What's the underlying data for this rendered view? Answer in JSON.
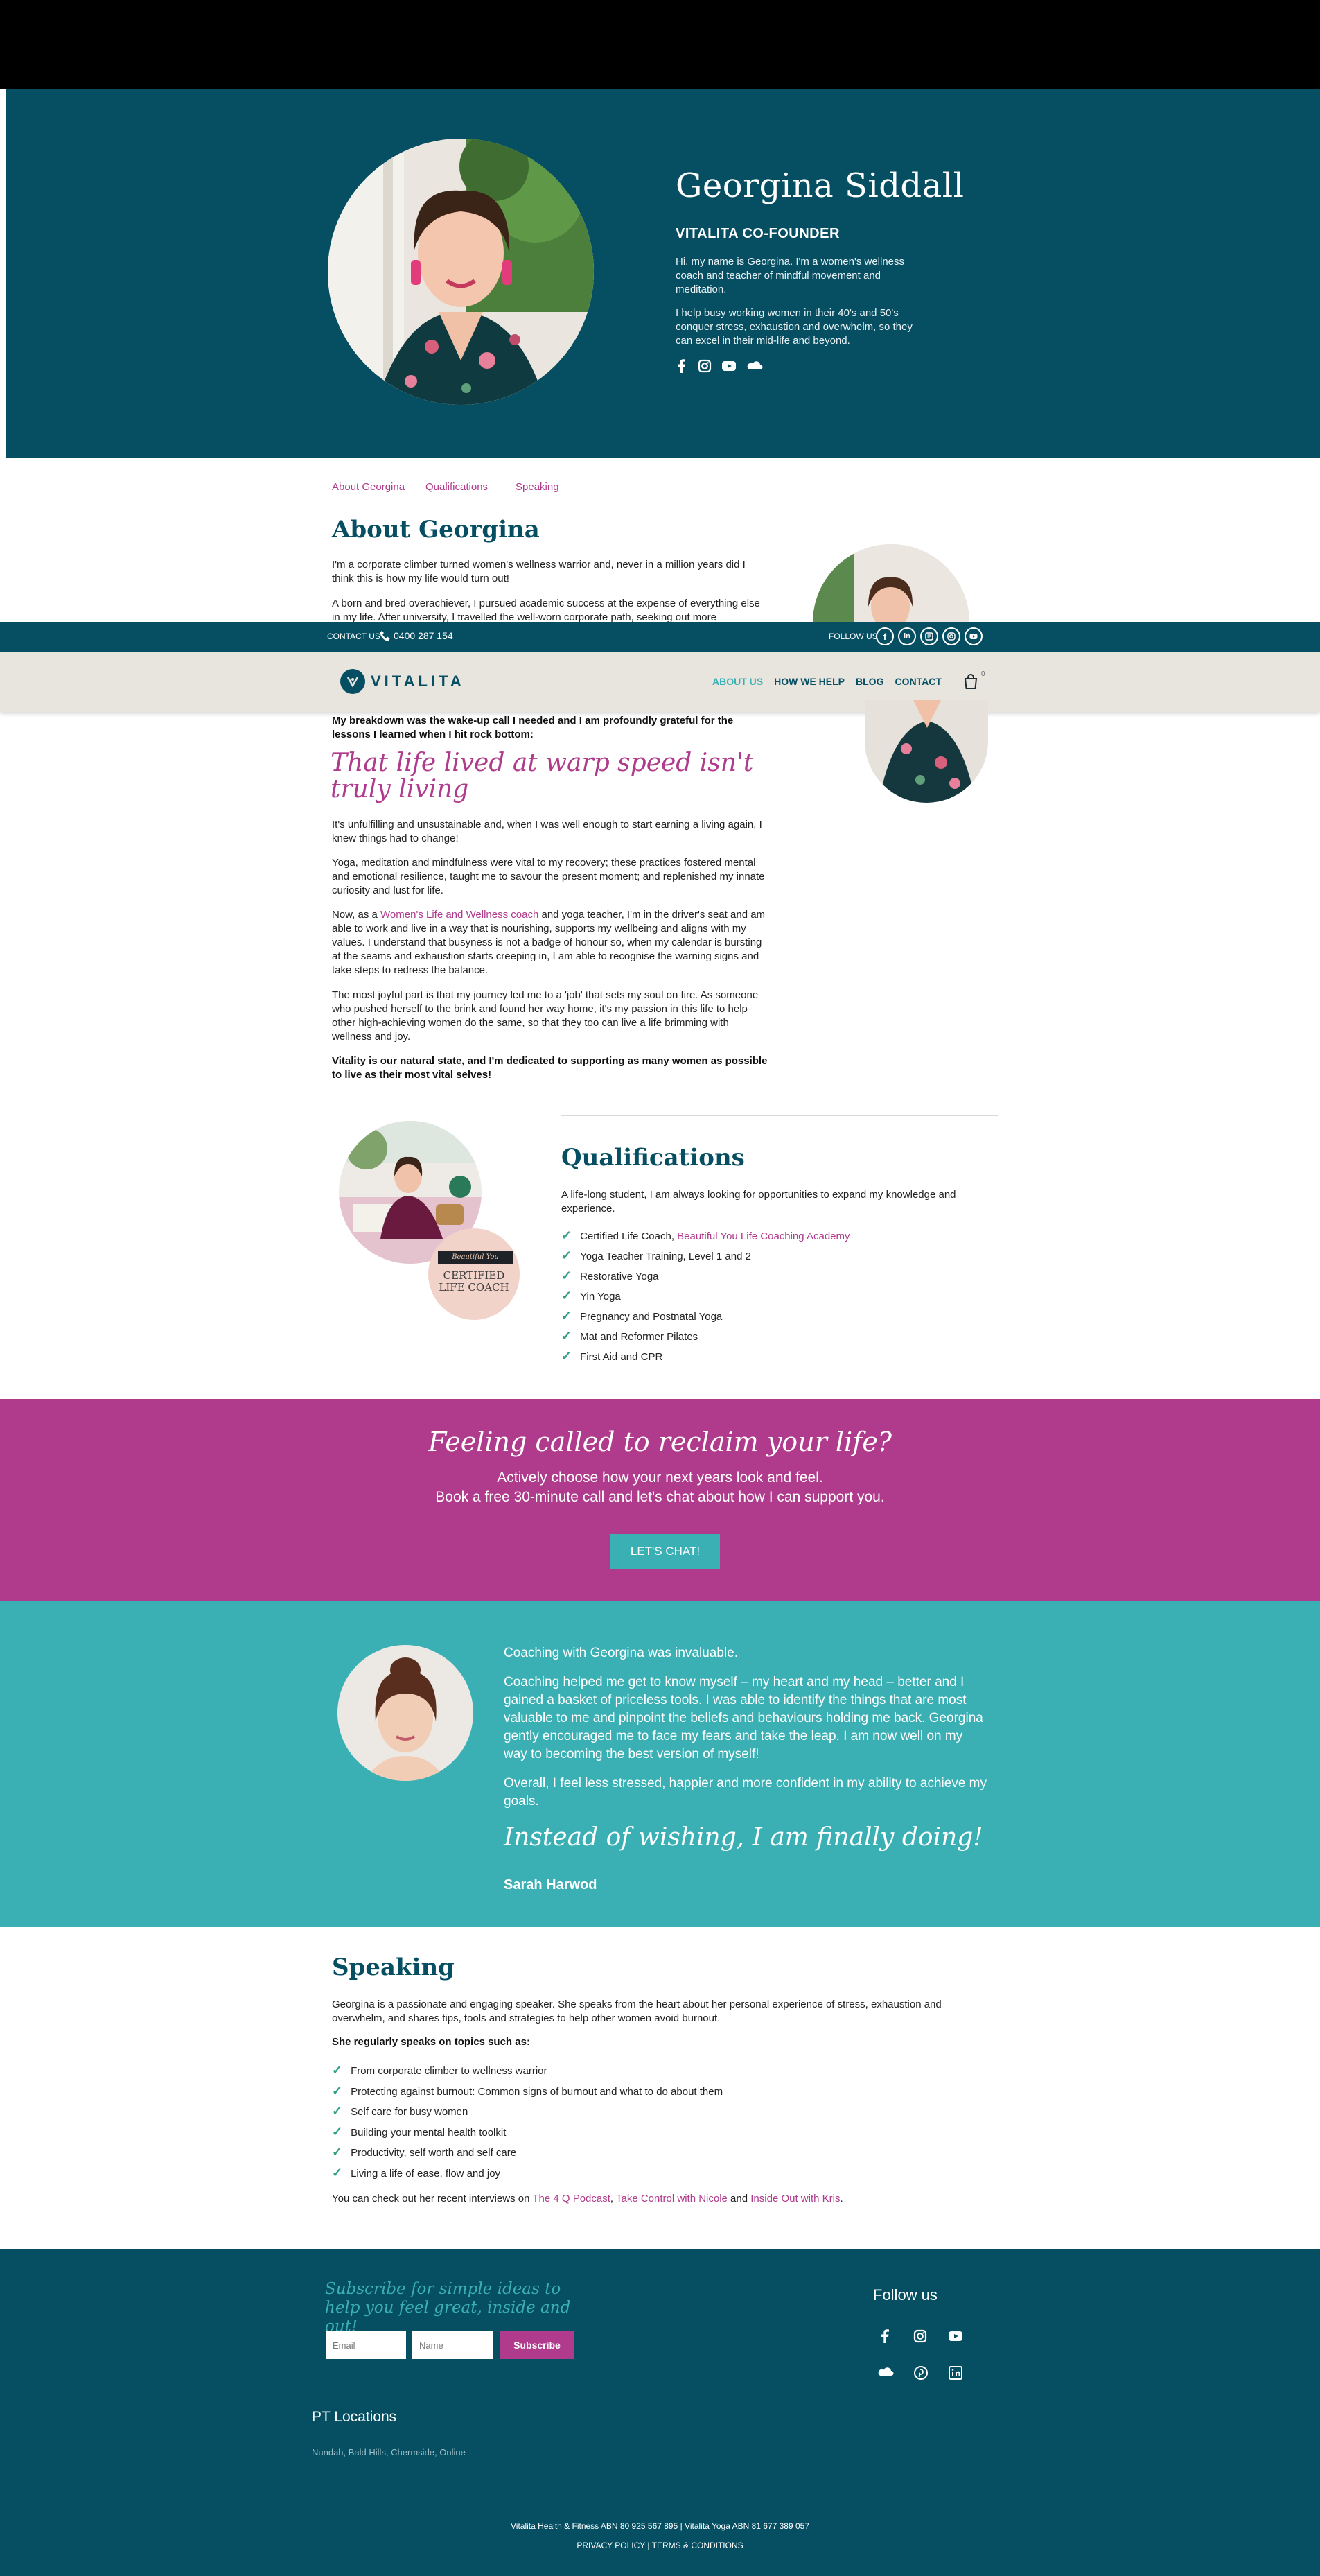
{
  "colors": {
    "teal_dark": "#064e62",
    "teal": "#3ab0b5",
    "magenta": "#b03a8c",
    "beige": "#e8e4de"
  },
  "hero": {
    "name": "Georgina Siddall",
    "role": "VITALITA CO-FOUNDER",
    "intro1": "Hi, my name is Georgina. I'm a women's wellness coach and teacher of mindful movement and meditation.",
    "intro2": "I help busy working women in their 40's and 50's conquer stress, exhaustion and overwhelm, so they can excel in their mid-life and beyond.",
    "social_icons": [
      "facebook-icon",
      "instagram-icon",
      "youtube-icon",
      "soundcloud-icon"
    ]
  },
  "anchors": [
    "About Georgina",
    "Qualifications",
    "Speaking"
  ],
  "topbar": {
    "contact_label": "CONTACT US",
    "phone": "0400 287 154",
    "follow_label": "FOLLOW US"
  },
  "nav": {
    "logo_text": "VITALITA",
    "items": [
      "ABOUT US",
      "HOW WE HELP",
      "BLOG",
      "CONTACT"
    ],
    "cart_count": "0"
  },
  "about": {
    "title": "About Georgina",
    "p1": "I'm a corporate climber turned women's wellness warrior and, never in a million years did I think this is how my life would turn out!",
    "p2_visible": "A born and bred overachiever, I pursued academic success at the expense of everything else in my life. After university, I travelled the well-worn corporate path, seeking out more",
    "breakdown": "My breakdown was the wake-up call I needed and I am profoundly grateful for the lessons I learned when I hit rock bottom:",
    "quote": "That life lived at warp speed isn't truly living",
    "p3": "It's unfulfilling and unsustainable and, when I was well enough to start earning a living again, I knew things had to change!",
    "p4": "Yoga, meditation and mindfulness were vital to my recovery; these practices fostered mental and emotional resilience, taught me to savour the present moment; and replenished my innate curiosity and lust for life.",
    "p5_before": "Now, as a ",
    "p5_link": "Women's Life and Wellness coach",
    "p5_after": " and yoga teacher, I'm in the driver's seat and am able to work and live in a way that is nourishing, supports my wellbeing and aligns with my values. I understand that busyness is not a badge of honour so, when my calendar is bursting at the seams and exhaustion starts creeping in, I am able to recognise the warning signs and take steps to redress the balance.",
    "p6": "The most joyful part is that my journey led me to a 'job' that sets my soul on fire. As someone who pushed herself to the brink and found her way home, it's my passion in this life to help other high-achieving women do the same, so that they too can live a life brimming with wellness and joy.",
    "p7": "Vitality is our natural state, and I'm dedicated to supporting as many women as possible to live as their most vital selves!"
  },
  "qualifications": {
    "title": "Qualifications",
    "intro": "A life-long student, I am always looking for opportunities to expand my knowledge and experience.",
    "first_item": "Certified Life Coach, ",
    "first_link": "Beautiful You Life Coaching Academy",
    "items": [
      "Yoga Teacher Training, Level 1 and 2",
      "Restorative Yoga",
      "Yin Yoga",
      "Pregnancy and Postnatal Yoga",
      "Mat and Reformer Pilates",
      "First Aid and CPR"
    ],
    "badge_top": "Beautiful You",
    "badge_main": "CERTIFIED LIFE COACH"
  },
  "cta": {
    "heading": "Feeling called to reclaim your life?",
    "line1": "Actively choose how your next years look and feel.",
    "line2": "Book a free 30-minute call and let's chat about how I can support you.",
    "button": "LET'S CHAT!"
  },
  "testimonial": {
    "lead": "Coaching with Georgina was invaluable.",
    "p1": "Coaching helped me get to know myself – my heart and my head – better and I gained a basket of priceless tools. I was able to identify the things that are most valuable to me and pinpoint the beliefs and behaviours holding me back. Georgina gently encouraged me to face my fears and take the leap. I am now well on my way to becoming the best version of myself!",
    "p2": "Overall, I feel less stressed, happier and more confident in my ability to achieve my goals.",
    "quote": "Instead of wishing, I am finally doing!",
    "author": "Sarah Harwod"
  },
  "speaking": {
    "title": "Speaking",
    "intro": "Georgina is a passionate and engaging speaker. She speaks from the heart about her personal experience of stress, exhaustion and overwhelm, and shares tips, tools and strategies to help other women avoid burnout.",
    "topics_label": "She regularly speaks on topics such as:",
    "topics": [
      "From corporate climber to wellness warrior",
      "Protecting against burnout: Common signs of burnout and what to do about them",
      "Self care for busy women",
      "Building your mental health toolkit",
      "Productivity, self worth and self care",
      "Living a life of ease, flow and joy"
    ],
    "interviews_before": "You can check out her recent interviews on ",
    "link1": "The 4 Q Podcast",
    "comma": ", ",
    "link2": "Take Control with Nicole",
    "and": " and ",
    "link3": "Inside Out with Kris",
    "period": "."
  },
  "footer": {
    "subscribe_heading": "Subscribe for simple ideas to help you feel great, inside and out!",
    "email_placeholder": "Email",
    "name_placeholder": "Name",
    "subscribe_button": "Subscribe",
    "follow_title": "Follow us",
    "locations_title": "PT Locations",
    "locations": "Nundah, Bald Hills, Chermside, Online",
    "legal": "Vitalita Health & Fitness ABN 80 925 567 895 | Vitalita Yoga ABN 81 677 389 057",
    "privacy": "PRIVACY POLICY",
    "sep": " | ",
    "terms": "TERMS & CONDITIONS"
  }
}
